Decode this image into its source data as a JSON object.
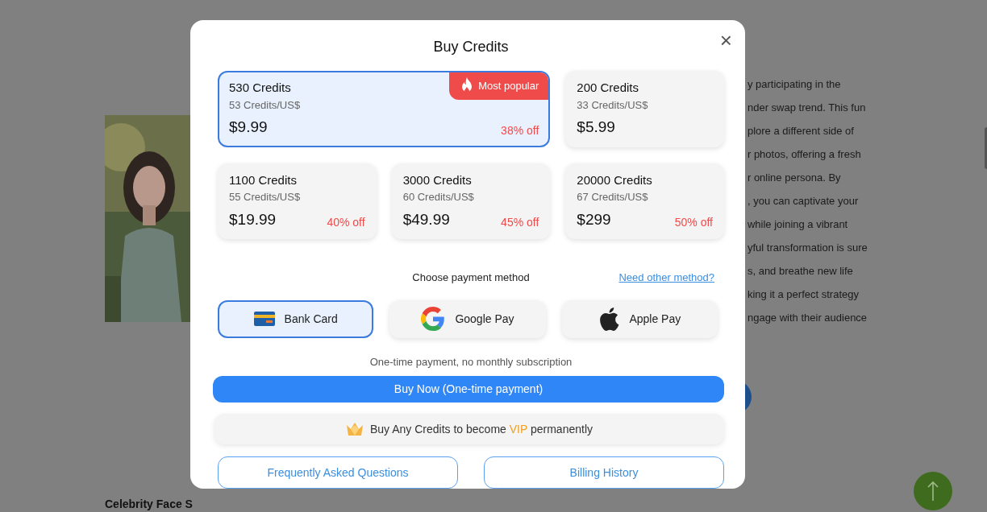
{
  "background_page": {
    "article_lines": [
      "y participating in the",
      "nder swap trend. This fun",
      "plore a different side of",
      "r photos, offering a fresh",
      "r online persona. By",
      ", you can captivate your",
      "while joining a vibrant",
      "yful transformation is sure",
      "s, and breathe new life",
      "king it a perfect strategy",
      "ngage with their audience"
    ],
    "section_heading": "Celebrity Face S"
  },
  "dialog": {
    "title": "Buy Credits",
    "close_label": "×",
    "plans": [
      {
        "credits": "530 Credits",
        "rate": "53 Credits/US$",
        "price": "$9.99",
        "discount": "38% off",
        "badge": "Most popular",
        "selected": true
      },
      {
        "credits": "200 Credits",
        "rate": "33 Credits/US$",
        "price": "$5.99",
        "selected": false
      },
      {
        "credits": "1100 Credits",
        "rate": "55 Credits/US$",
        "price": "$19.99",
        "discount": "40% off",
        "selected": false
      },
      {
        "credits": "3000 Credits",
        "rate": "60 Credits/US$",
        "price": "$49.99",
        "discount": "45% off",
        "selected": false
      },
      {
        "credits": "20000 Credits",
        "rate": "67 Credits/US$",
        "price": "$299",
        "discount": "50% off",
        "selected": false
      }
    ],
    "payment_heading": "Choose payment method",
    "other_method_link": "Need other method?",
    "payment_methods": [
      {
        "kind": "card",
        "label": "Bank Card",
        "selected": true
      },
      {
        "kind": "google",
        "label": "Google Pay",
        "selected": false
      },
      {
        "kind": "apple",
        "label": "Apple Pay",
        "selected": false
      }
    ],
    "note": "One-time payment, no monthly subscription",
    "buy_button": "Buy Now (One-time payment)",
    "vip_banner": {
      "before": "Buy Any Credits to become",
      "highlight": "VIP",
      "after": "permanently"
    },
    "footer_buttons": [
      "Frequently Asked Questions",
      "Billing History"
    ]
  }
}
